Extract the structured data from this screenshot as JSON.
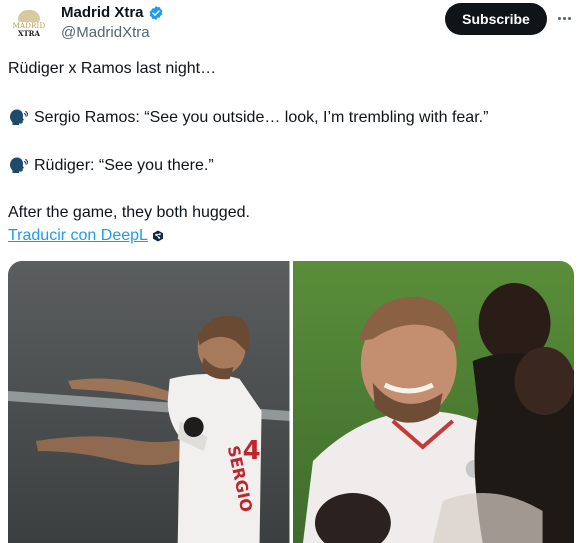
{
  "author": {
    "avatar_line1": "MADRID",
    "avatar_line2": "XTRA",
    "display_name": "Madrid Xtra",
    "handle": "@MadridXtra",
    "verified_icon": "verified-badge-icon",
    "verified_color": "#1d9bf0"
  },
  "actions": {
    "subscribe_label": "Subscribe",
    "more_icon": "more-horizontal-icon"
  },
  "tweet": {
    "line1": "Rüdiger x Ramos last night…",
    "line2": "Sergio Ramos: “See you outside… look, I’m trembling with fear.”",
    "line3": "Rüdiger: “See you there.”",
    "line4": "After the game, they both hugged.",
    "speech_icon": "speaking-head-icon",
    "translate_label": "Traducir con DeepL",
    "translate_icon": "deepl-icon"
  },
  "media": {
    "left_photo": "photo-ramos-gesturing",
    "right_photo": "photo-ramos-hug"
  },
  "colors": {
    "text": "#0f1419",
    "secondary": "#536471",
    "link": "#1d9bf0",
    "button": "#0f1419"
  }
}
